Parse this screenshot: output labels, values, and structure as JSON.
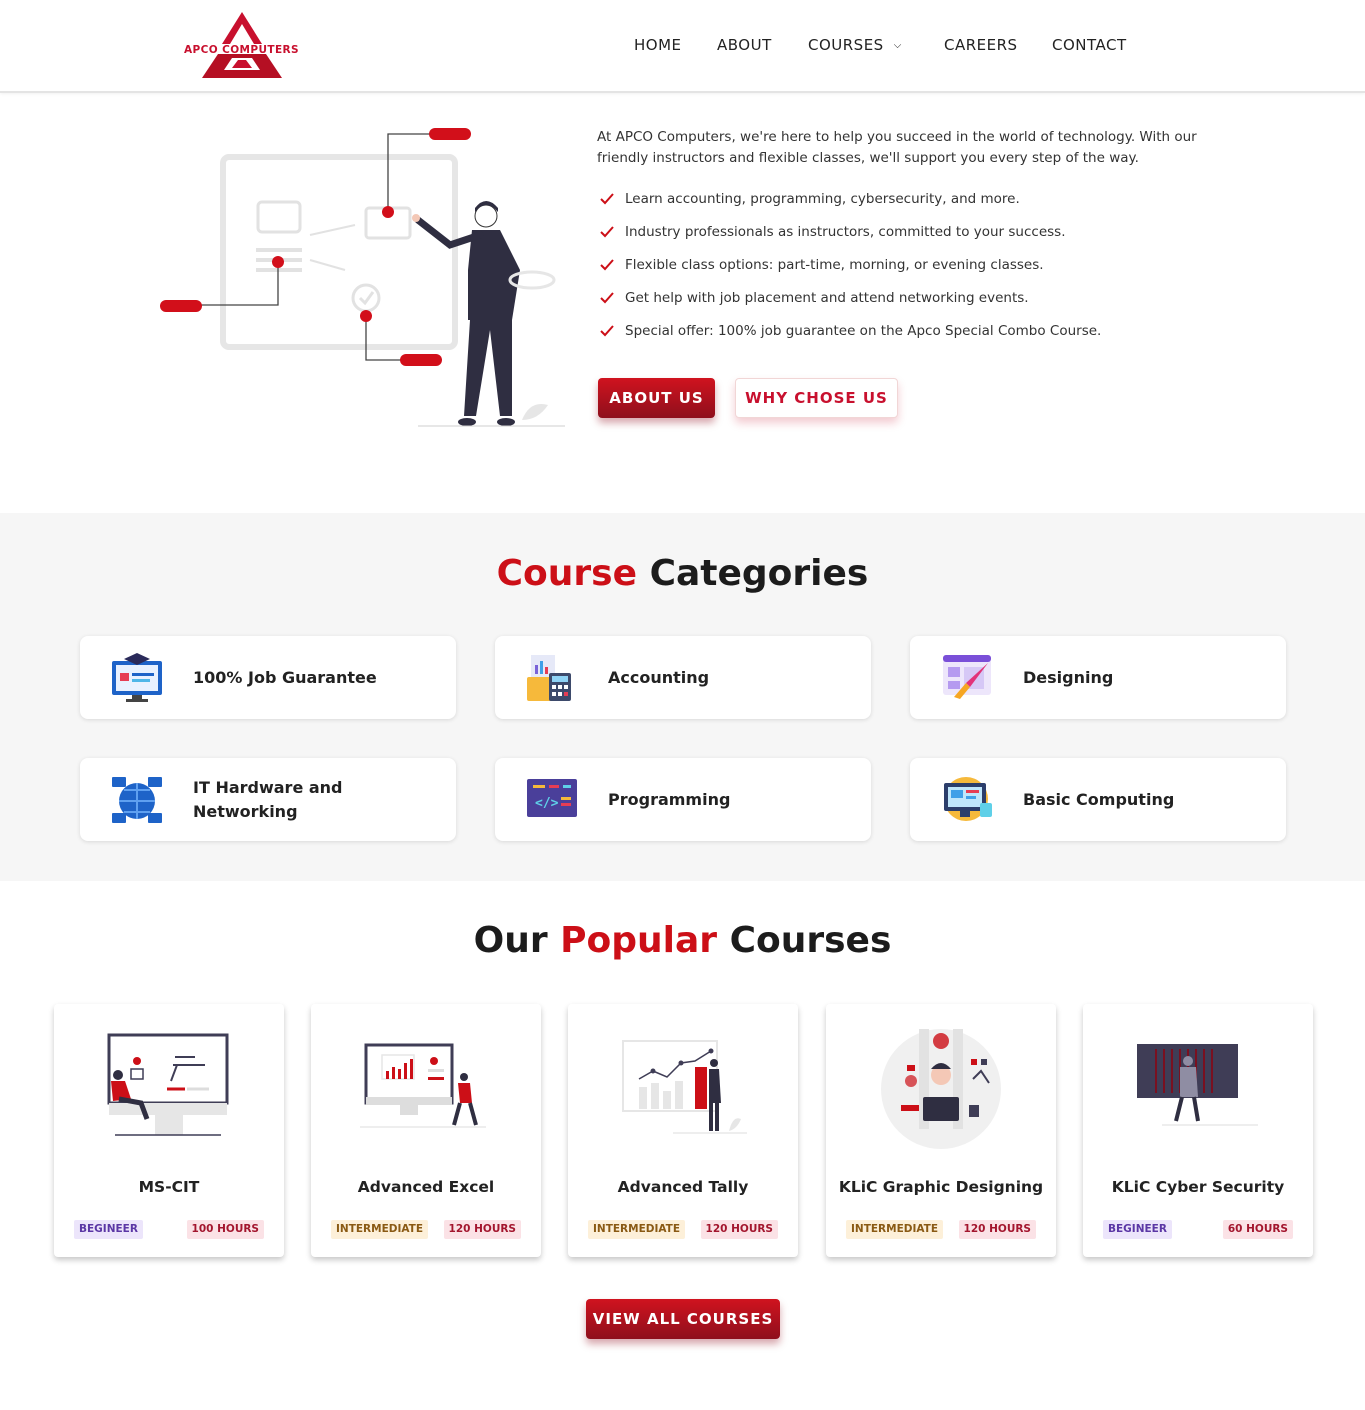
{
  "brand": {
    "name": "APCO COMPUTERS",
    "accent": "#cc0f17",
    "dark_red": "#8e0f1c"
  },
  "nav": {
    "home": "HOME",
    "about": "ABOUT",
    "courses": "COURSES",
    "careers": "CAREERS",
    "contact": "CONTACT"
  },
  "about": {
    "intro": "At APCO Computers, we're here to help you succeed in the world of technology. With our friendly instructors and flexible classes, we'll support you every step of the way.",
    "features": [
      "Learn accounting, programming, cybersecurity, and more.",
      "Industry professionals as instructors, committed to your success.",
      "Flexible class options: part-time, morning, or evening classes.",
      "Get help with job placement and attend networking events.",
      "Special offer: 100% job guarantee on the Apco Special Combo Course."
    ],
    "about_button": "ABOUT US",
    "why_button": "WHY CHOSE US"
  },
  "categories": {
    "title_red": "Course",
    "title_rest": "Categories",
    "items": [
      {
        "label": "100% Job Guarantee",
        "icon": "graduation-monitor-icon"
      },
      {
        "label": "Accounting",
        "icon": "accounting-calculator-icon"
      },
      {
        "label": "Designing",
        "icon": "design-brush-icon"
      },
      {
        "label": "IT Hardware and Networking",
        "icon": "network-globe-icon"
      },
      {
        "label": "Programming",
        "icon": "code-window-icon"
      },
      {
        "label": "Basic Computing",
        "icon": "basic-computer-icon"
      }
    ]
  },
  "popular": {
    "title_start": "Our",
    "title_red": "Popular",
    "title_end": "Courses",
    "courses": [
      {
        "title": "MS-CIT",
        "level": "BEGINEER",
        "hours": "100 HOURS"
      },
      {
        "title": "Advanced Excel",
        "level": "INTERMEDIATE",
        "hours": "120 HOURS"
      },
      {
        "title": "Advanced Tally",
        "level": "INTERMEDIATE",
        "hours": "120 HOURS"
      },
      {
        "title": "KLiC Graphic Designing",
        "level": "INTERMEDIATE",
        "hours": "120 HOURS"
      },
      {
        "title": "KLiC Cyber Security",
        "level": "BEGINEER",
        "hours": "60 HOURS"
      }
    ],
    "view_all": "VIEW ALL COURSES"
  }
}
